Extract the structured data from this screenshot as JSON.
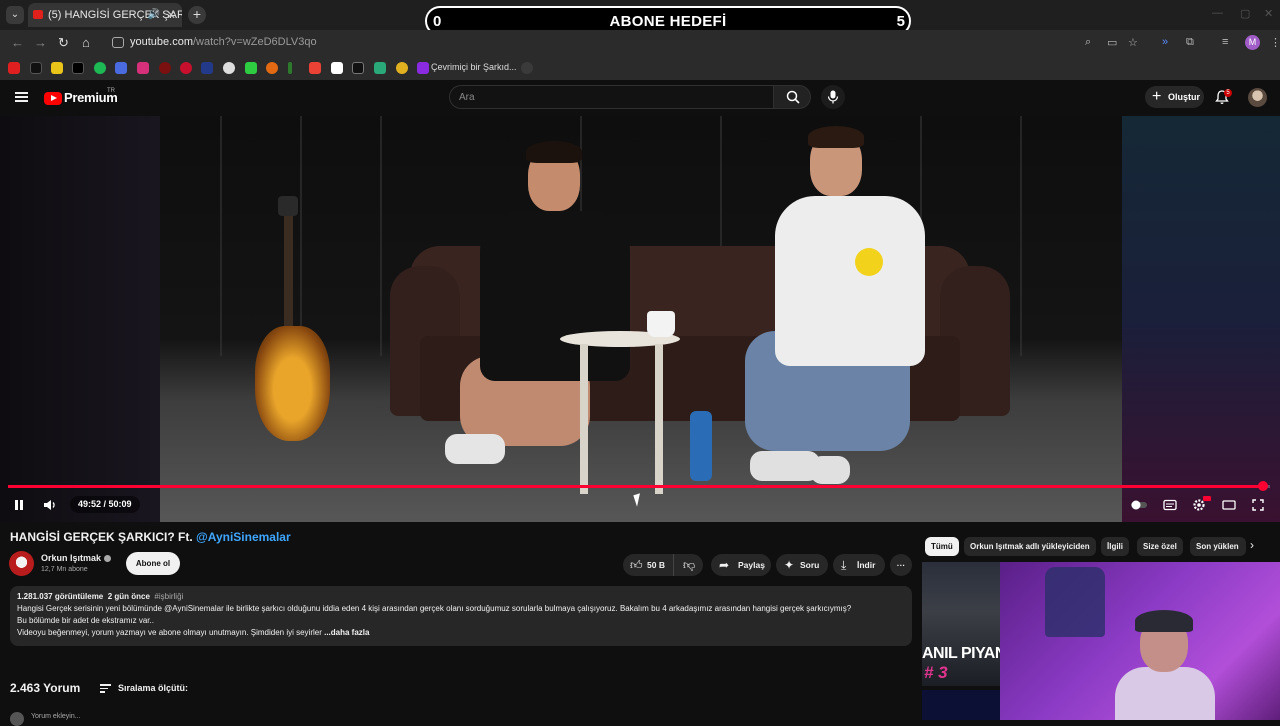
{
  "browser": {
    "tab_title": "(5) HANGİSİ GERÇEK ŞARKI",
    "tab_close": "✕",
    "new_tab": "+",
    "url_host": "youtube.com",
    "url_path": "/watch?v=wZeD6DLV3qo",
    "bookmark_label": "Çevrimiçi bir Şarkıd...",
    "profile_initial": "M"
  },
  "goal": {
    "start": "0",
    "title": "ABONE HEDEFİ",
    "end": "5"
  },
  "youtube": {
    "brand": "Premium",
    "region": "TR",
    "search_placeholder": "Ara",
    "create_label": "Oluştur",
    "notification_count": "5"
  },
  "player": {
    "time": "49:52 / 50:09",
    "progress": 0.9944
  },
  "video": {
    "title": "HANGİSİ GERÇEK ŞARKICI? Ft. ",
    "title_mention": "@AyniSinemalar",
    "channel_name": "Orkun Işıtmak",
    "subscribers": "12,7 Mn abone",
    "subscribe_label": "Abone ol",
    "likes": "50 B",
    "share_label": "Paylaş",
    "ask_label": "Soru",
    "download_label": "İndir",
    "more_label": "···"
  },
  "description": {
    "views": "1.281.037 görüntüleme",
    "age": "2 gün önce",
    "tag": "#işbirliği",
    "line1": "Hangisi Gerçek serisinin yeni bölümünde @AyniSinemalar ile birlikte şarkıcı olduğunu iddia eden 4 kişi arasından gerçek olanı sorduğumuz sorularla bulmaya çalışıyoruz. Bakalım bu 4 arkadaşımız arasından hangisi gerçek şarkıcıymış?",
    "line2": "Bu bölümde bir adet de ekstramız var..",
    "line3": "Videoyu beğenmeyi, yorum yazmayı ve abone olmayı unutmayın. Şimdiden iyi seyirler ",
    "more": "...daha fazla"
  },
  "comments": {
    "count": "2.463 Yorum",
    "sort_label": "Sıralama ölçütü:",
    "add_placeholder": "Yorum ekleyin..."
  },
  "chips": [
    "Tümü",
    "Orkun Işıtmak adlı yükleyiciden",
    "İlgili",
    "Size özel",
    "Son yüklen"
  ],
  "recommended": {
    "thumb_text": "ANIL PIYANC",
    "thumb_num": "# 3"
  },
  "colors": {
    "accent_red": "#ff0033",
    "link_blue": "#3ea6ff",
    "goal_border": "#ffffff"
  }
}
